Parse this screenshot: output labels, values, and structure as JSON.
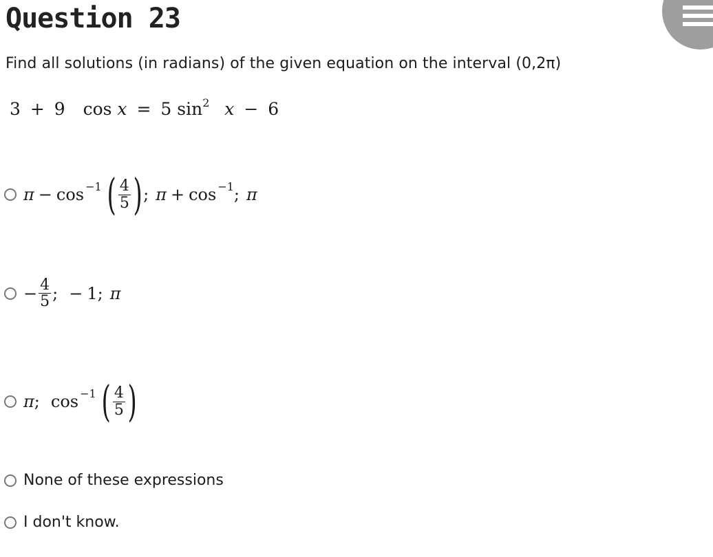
{
  "header": {
    "title": "Question 23",
    "menu_icon": "hamburger-menu-icon"
  },
  "question": {
    "prompt": "Find all solutions (in radians) of the given equation on the interval (0,2π)",
    "equation": {
      "lhs_const": "3",
      "plus": "+",
      "coef": "9",
      "cos": "cos",
      "var": "x",
      "equals": "=",
      "rhs_coef": "5",
      "sin": "sin",
      "exponent": "2",
      "minus": "−",
      "rhs_const": "6"
    }
  },
  "options": [
    {
      "id": "a",
      "parts": {
        "pi1": "π",
        "minus": "−",
        "cos": "cos",
        "inv": "−1",
        "num": "4",
        "den": "5",
        "semi1": ";",
        "pi2": "π",
        "plus": "+",
        "cos2": "cos",
        "inv2": "−1",
        "semi2": ";",
        "pi3": "π"
      }
    },
    {
      "id": "b",
      "parts": {
        "neg": "−",
        "num": "4",
        "den": "5",
        "semi1": ";",
        "neg2": "−",
        "one": "1",
        "semi2": ";",
        "pi": "π"
      }
    },
    {
      "id": "c",
      "parts": {
        "pi": "π",
        "semi": ";",
        "cos": "cos",
        "inv": "−1",
        "num": "4",
        "den": "5"
      }
    },
    {
      "id": "d",
      "label": "None of these expressions"
    },
    {
      "id": "e",
      "label": "I don't know."
    }
  ]
}
